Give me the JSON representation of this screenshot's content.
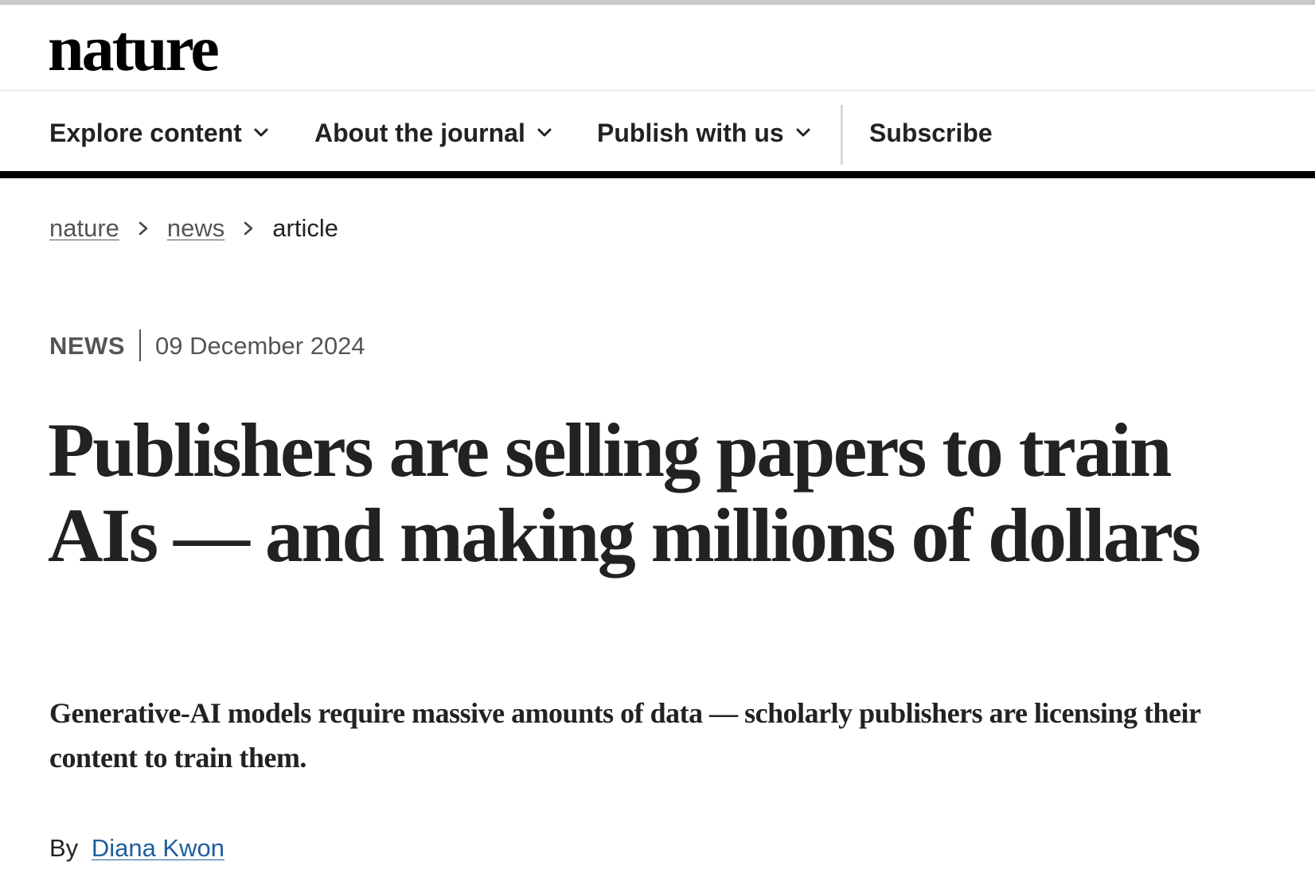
{
  "site": {
    "logo_text": "nature"
  },
  "nav": {
    "items": [
      {
        "label": "Explore content",
        "has_dropdown": true
      },
      {
        "label": "About the journal",
        "has_dropdown": true
      },
      {
        "label": "Publish with us",
        "has_dropdown": true
      }
    ],
    "subscribe_label": "Subscribe"
  },
  "breadcrumb": {
    "items": [
      {
        "label": "nature",
        "link": true
      },
      {
        "label": "news",
        "link": true
      },
      {
        "label": "article",
        "link": false
      }
    ],
    "separator_icon": "chevron-right-icon"
  },
  "article": {
    "type_label": "NEWS",
    "date": "09 December 2024",
    "title": "Publishers are selling papers to train AIs — and making millions of dollars",
    "standfirst": "Generative-AI models require massive amounts of data — scholarly publishers are licensing their content to train them.",
    "byline_prefix": "By",
    "author": "Diana Kwon"
  },
  "colors": {
    "text": "#222222",
    "muted": "#555555",
    "link": "#1f5f9e",
    "nav_rule": "#000000",
    "top_strip": "#c8c8c8"
  }
}
